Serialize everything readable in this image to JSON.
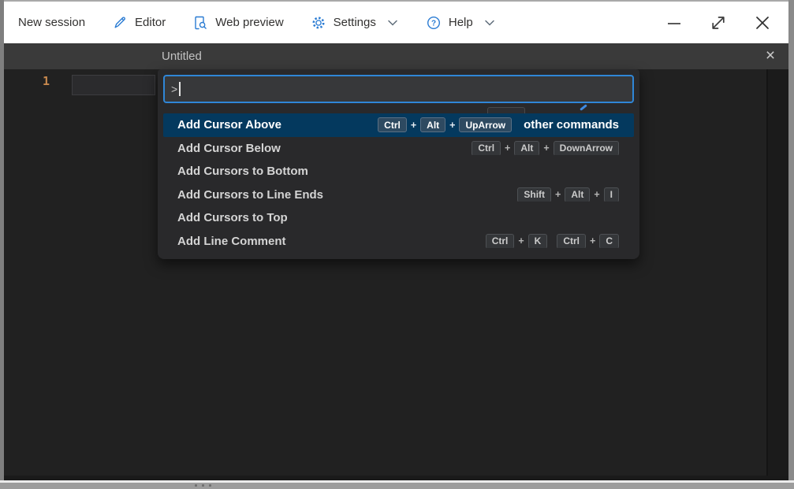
{
  "menubar": {
    "new_session": "New session",
    "editor": "Editor",
    "web_preview": "Web preview",
    "settings": "Settings",
    "help": "Help"
  },
  "window_controls": {
    "minimize": "minimize",
    "resize": "resize",
    "close": "close"
  },
  "tab": {
    "title": "Untitled",
    "close_glyph": "×"
  },
  "editor": {
    "line_number": "1"
  },
  "palette": {
    "input": {
      "value": ">"
    },
    "rows": [
      {
        "label": "Add Cursor Above",
        "selected": true,
        "keybindings": [
          [
            "Ctrl",
            "Alt",
            "UpArrow"
          ]
        ],
        "trailing_text": "other commands"
      },
      {
        "label": "Add Cursor Below",
        "selected": false,
        "keybindings": [
          [
            "Ctrl",
            "Alt",
            "DownArrow"
          ]
        ]
      },
      {
        "label": "Add Cursors to Bottom",
        "selected": false,
        "keybindings": []
      },
      {
        "label": "Add Cursors to Line Ends",
        "selected": false,
        "keybindings": [
          [
            "Shift",
            "Alt",
            "I"
          ]
        ]
      },
      {
        "label": "Add Cursors to Top",
        "selected": false,
        "keybindings": []
      },
      {
        "label": "Add Line Comment",
        "selected": false,
        "keybindings": [
          [
            "Ctrl",
            "K"
          ],
          [
            "Ctrl",
            "C"
          ]
        ]
      }
    ]
  },
  "colors": {
    "accent_blue": "#2b7cd3",
    "input_border": "#2f86d7",
    "selected_row_bg": "#04395e",
    "editor_bg": "#212121",
    "tabbar_bg": "#3a3a3a",
    "titlebar_bg": "#ffffff",
    "line_number": "#c8894e"
  }
}
